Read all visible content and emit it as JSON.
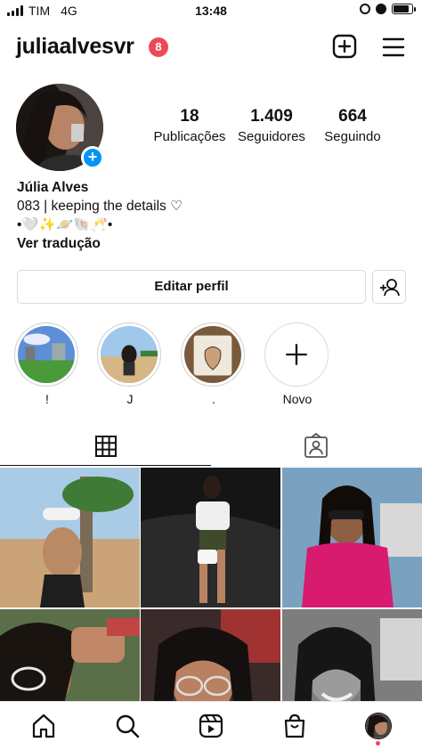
{
  "status_bar": {
    "carrier": "TIM",
    "network": "4G",
    "time": "13:48",
    "battery_level": 0.85
  },
  "header": {
    "username": "juliaalvesvr",
    "notification_count": "8"
  },
  "stats": [
    {
      "value": "18",
      "label": "Publicações"
    },
    {
      "value": "1.409",
      "label": "Seguidores"
    },
    {
      "value": "664",
      "label": "Seguindo"
    }
  ],
  "bio": {
    "name": "Júlia Alves",
    "line1": "083 | keeping the details ♡",
    "line2": "•🤍✨🪐🐚🥂•",
    "translate": "Ver tradução"
  },
  "buttons": {
    "edit_profile": "Editar perfil"
  },
  "highlights": [
    {
      "label": "!"
    },
    {
      "label": "J"
    },
    {
      "label": "."
    },
    {
      "label": "Novo"
    }
  ],
  "tabs": [
    "grid-icon",
    "tagged-icon"
  ],
  "icons": [
    "add-post-icon",
    "menu-icon",
    "home-icon",
    "search-icon",
    "reels-icon",
    "shop-icon",
    "profile-avatar"
  ],
  "colors": {
    "badge": "#ed4956",
    "accent_blue": "#0095f6",
    "border": "#dbdbdb"
  }
}
